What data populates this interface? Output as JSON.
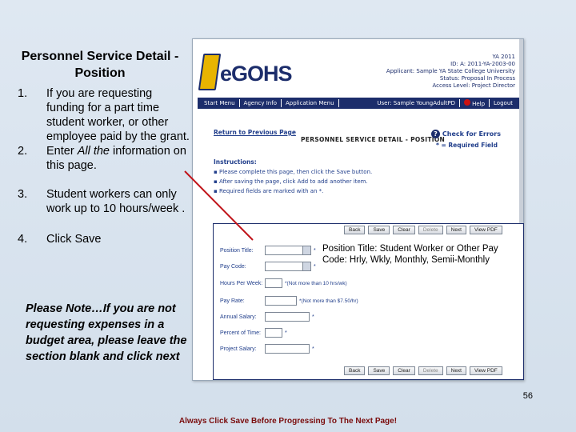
{
  "slide": {
    "title": "Personnel Service Detail - Position",
    "steps": [
      {
        "num": "1.",
        "text": "If you are requesting funding for a part time student worker, or other employee paid by the grant."
      },
      {
        "num": "2.",
        "text_pre": "Enter ",
        "text_em": "All the",
        "text_post": " information on this page."
      },
      {
        "num": "3.",
        "text": "Student workers can only work up to 10 hours/week ."
      },
      {
        "num": "4.",
        "text": "Click Save"
      }
    ],
    "note": "Please Note…If you are not requesting expenses in a budget area, please leave the section blank and click next",
    "callout": "Position Title:  Student Worker or Other Pay Code: Hrly, Wkly, Monthly, Semii-Monthly",
    "page_number": "56",
    "footer": "Always Click Save Before Progressing To The Next Page!",
    "accent_color": "#c0141a"
  },
  "app": {
    "logo": "eGOHS",
    "info_lines": [
      "YA 2011",
      "ID: A: 2011-YA-2003-00",
      "Applicant: Sample YA State College University",
      "Status: Proposal In Process",
      "Access Level: Project Director"
    ],
    "menu": [
      "Start Menu",
      "Agency Info",
      "Application Menu"
    ],
    "user": "User: Sample YoungAdultPD",
    "help": "Help",
    "logoff": "Logout",
    "return_link": "Return to Previous Page",
    "heading": "PERSONNEL SERVICE DETAIL - POSITION",
    "check_errors": "Check for Errors",
    "required_field": "* = Required Field",
    "instructions_title": "Instructions:",
    "instructions": [
      "Please complete this page, then click the Save button.",
      "After saving the page, click Add to add another item.",
      "Required fields are marked with an *."
    ],
    "buttons": [
      "Back",
      "Save",
      "Clear",
      "Delete",
      "Next",
      "View PDF"
    ],
    "form": {
      "position_title": "Position Title:",
      "pay_code": "Pay Code:",
      "hours_per_week": "Hours Per Week:",
      "hours_hint": "*(Not more than 10 hrs/wk)",
      "pay_rate": "Pay Rate:",
      "pay_rate_hint": "*(Not more than $7.50/hr)",
      "annual_salary": "Annual Salary:",
      "percent_time": "Percent of Time:",
      "project_salary": "Project Salary:",
      "star": "*"
    }
  }
}
